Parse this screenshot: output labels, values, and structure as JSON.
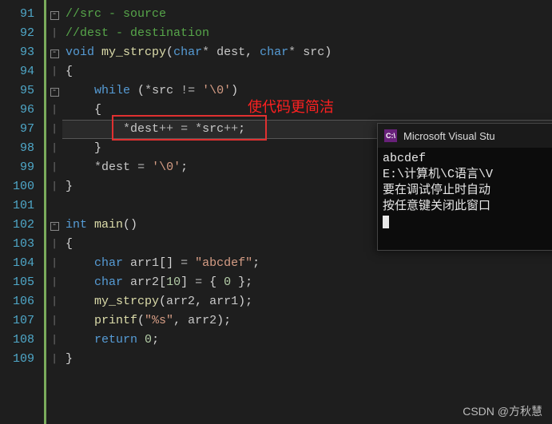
{
  "gutter": {
    "lines": [
      "91",
      "92",
      "93",
      "94",
      "95",
      "96",
      "97",
      "98",
      "99",
      "100",
      "101",
      "102",
      "103",
      "104",
      "105",
      "106",
      "107",
      "108",
      "109"
    ]
  },
  "code": {
    "l91": "//src - source",
    "l92": "//dest - destination",
    "l93_kw": "void",
    "l93_fn": "my_strcpy",
    "l93_tp1": "char",
    "l93_p1": "dest",
    "l93_tp2": "char",
    "l93_p2": "src",
    "l95_kw": "while",
    "l95_id": "src",
    "l95_str": "'\\0'",
    "l97_d": "dest",
    "l97_s": "src",
    "l99_d": "dest",
    "l99_str": "'\\0'",
    "l102_tp": "int",
    "l102_fn": "main",
    "l104_tp": "char",
    "l104_id": "arr1",
    "l104_str": "\"abcdef\"",
    "l105_tp": "char",
    "l105_id": "arr2",
    "l105_sz": "10",
    "l105_z": "0",
    "l106_fn": "my_strcpy",
    "l106_a1": "arr2",
    "l106_a2": "arr1",
    "l107_fn": "printf",
    "l107_fmt": "\"%s\"",
    "l107_a": "arr2",
    "l108_kw": "return",
    "l108_v": "0"
  },
  "annotation": "使代码更简洁",
  "console": {
    "title": "Microsoft Visual Stu",
    "icon_text": "C:\\",
    "lines": [
      "abcdef",
      "E:\\计算机\\C语言\\V",
      "要在调试停止时自动",
      "按任意键关闭此窗口"
    ]
  },
  "watermark": "CSDN @方秋慧"
}
